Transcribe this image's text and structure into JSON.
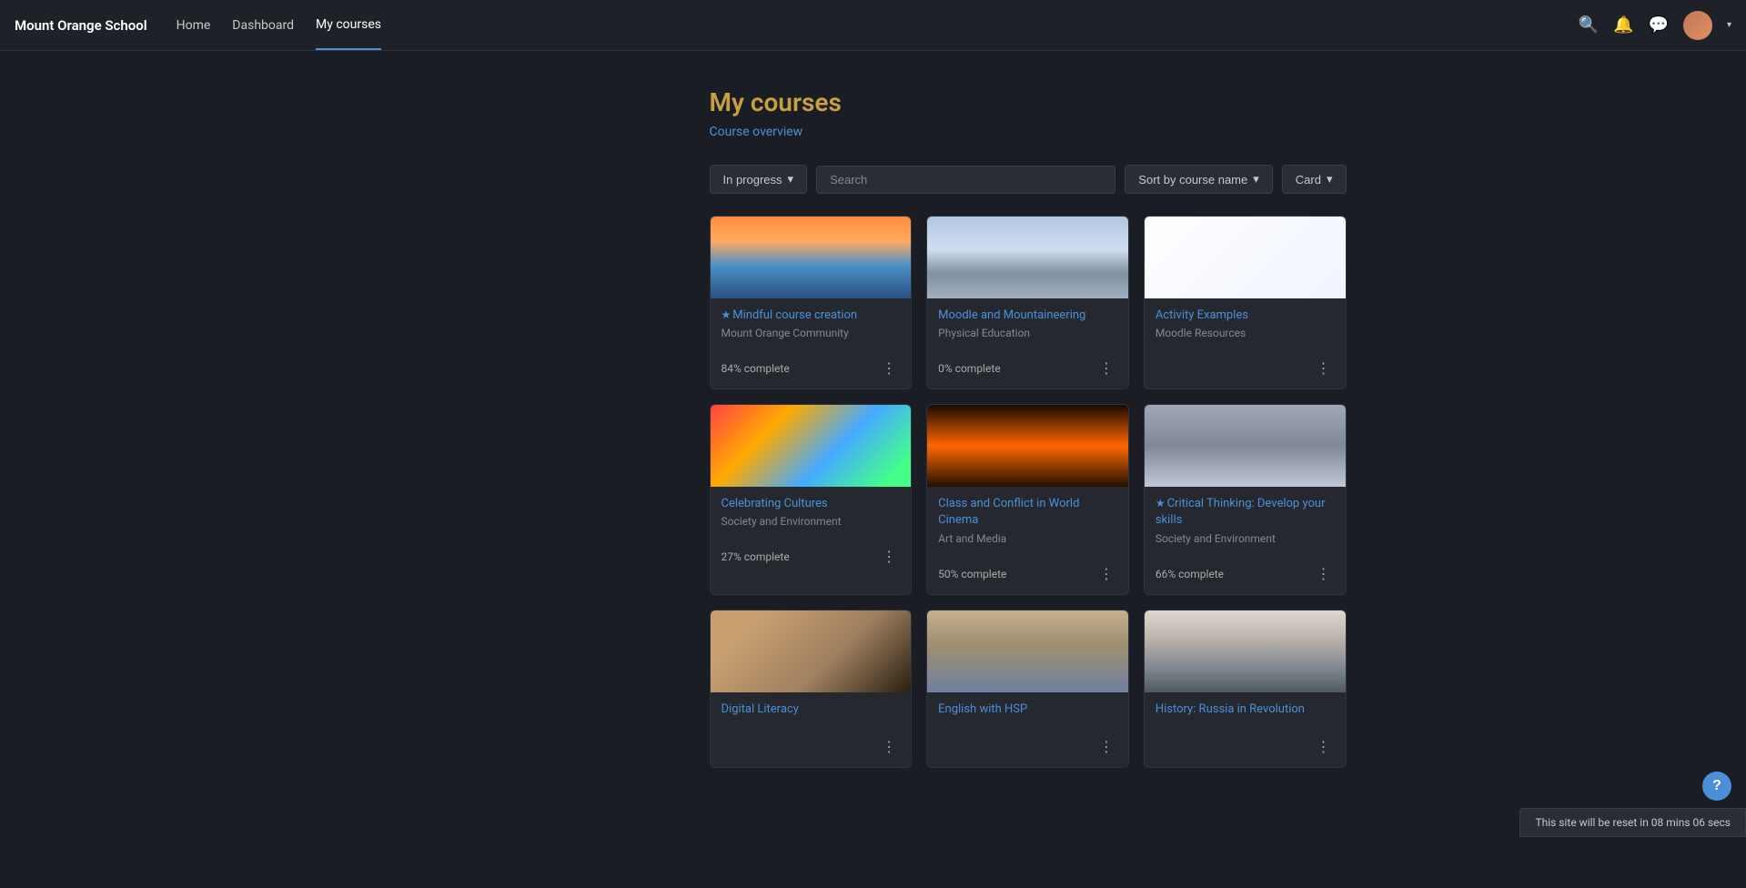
{
  "site": {
    "brand": "Mount Orange School",
    "nav": [
      {
        "label": "Home",
        "active": false
      },
      {
        "label": "Dashboard",
        "active": false
      },
      {
        "label": "My courses",
        "active": true
      }
    ]
  },
  "page": {
    "title": "My courses",
    "subtitle": "Course overview"
  },
  "filters": {
    "status_label": "In progress",
    "status_caret": "▾",
    "search_placeholder": "Search",
    "sort_label": "Sort by course name",
    "sort_caret": "▾",
    "view_label": "Card",
    "view_caret": "▾"
  },
  "courses": [
    {
      "id": "course-1",
      "title": "Mindful course creation",
      "starred": true,
      "category": "Mount Orange Community",
      "progress": "84% complete",
      "thumb_class": "thumb-swans"
    },
    {
      "id": "course-2",
      "title": "Moodle and Mountaineering",
      "starred": false,
      "category": "Physical Education",
      "progress": "0% complete",
      "thumb_class": "thumb-mountain"
    },
    {
      "id": "course-3",
      "title": "Activity Examples",
      "starred": false,
      "category": "Moodle Resources",
      "progress": "",
      "thumb_class": "thumb-activity"
    },
    {
      "id": "course-4",
      "title": "Celebrating Cultures",
      "starred": false,
      "category": "Society and Environment",
      "progress": "27% complete",
      "thumb_class": "thumb-umbrellas"
    },
    {
      "id": "course-5",
      "title": "Class and Conflict in World Cinema",
      "starred": false,
      "category": "Art and Media",
      "progress": "50% complete",
      "thumb_class": "thumb-cinema"
    },
    {
      "id": "course-6",
      "title": "Critical Thinking: Develop your skills",
      "starred": true,
      "category": "Society and Environment",
      "progress": "66% complete",
      "thumb_class": "thumb-thinking"
    },
    {
      "id": "course-7",
      "title": "Digital Literacy",
      "starred": false,
      "category": "",
      "progress": "",
      "thumb_class": "thumb-laptop"
    },
    {
      "id": "course-8",
      "title": "English with HSP",
      "starred": false,
      "category": "",
      "progress": "",
      "thumb_class": "thumb-london"
    },
    {
      "id": "course-9",
      "title": "History: Russia in Revolution",
      "starred": false,
      "category": "",
      "progress": "",
      "thumb_class": "thumb-russia"
    }
  ],
  "footer": {
    "reset_text": "This site will be reset in 08 mins 06 secs"
  },
  "icons": {
    "search": "🔍",
    "bell": "🔔",
    "chat": "💬",
    "help": "?",
    "menu": "⋮",
    "star": "★"
  }
}
